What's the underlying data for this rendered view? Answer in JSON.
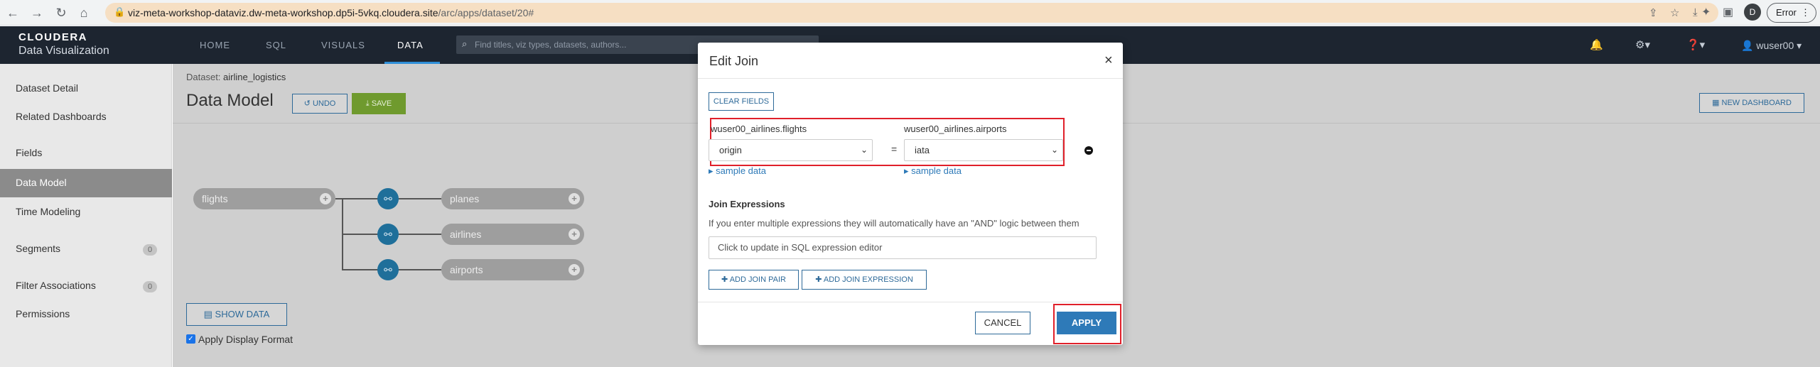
{
  "browser": {
    "url_host": "viz-meta-workshop-dataviz.dw-meta-workshop.dp5i-5vkq.cloudera.site",
    "url_path": "/arc/apps/dataset/20#",
    "profile_initial": "D",
    "error_label": "Error"
  },
  "navbar": {
    "brand_top": "CLOUDERA",
    "brand_bottom": "Data Visualization",
    "items": [
      "HOME",
      "SQL",
      "VISUALS",
      "DATA"
    ],
    "active": "DATA",
    "search_placeholder": "Find titles, viz types, datasets, authors...",
    "user": "wuser00"
  },
  "sidebar": {
    "items": [
      {
        "label": "Dataset Detail"
      },
      {
        "label": "Related Dashboards"
      },
      {
        "label": "Fields"
      },
      {
        "label": "Data Model"
      },
      {
        "label": "Time Modeling"
      },
      {
        "label": "Segments",
        "count": "0"
      },
      {
        "label": "Filter Associations",
        "count": "0"
      },
      {
        "label": "Permissions"
      }
    ],
    "active": "Data Model"
  },
  "main": {
    "dataset_prefix": "Dataset:",
    "dataset_name": "airline_logistics",
    "title": "Data Model",
    "undo_label": "UNDO",
    "save_label": "SAVE",
    "new_dashboard_label": "NEW DASHBOARD",
    "show_data_label": "SHOW DATA",
    "apply_format_label": "Apply Display Format",
    "join_diagram": {
      "left_table": "flights",
      "right_tables": [
        "planes",
        "airlines",
        "airports"
      ]
    }
  },
  "modal": {
    "title": "Edit Join",
    "clear_fields_label": "CLEAR FIELDS",
    "left_table": "wuser00_airlines.flights",
    "right_table": "wuser00_airlines.airports",
    "left_column": "origin",
    "right_column": "iata",
    "operator": "=",
    "sample_data_label": "sample data",
    "join_expr_title": "Join Expressions",
    "join_expr_desc": "If you enter multiple expressions they will automatically have an \"AND\" logic between them",
    "expr_placeholder": "Click to update in SQL expression editor",
    "add_join_pair_label": "ADD JOIN PAIR",
    "add_join_expr_label": "ADD JOIN EXPRESSION",
    "cancel_label": "CANCEL",
    "apply_label": "APPLY"
  },
  "colors": {
    "accent": "#2e7ab8",
    "navbar_bg": "#1d2530",
    "save_green": "#6f9a2e",
    "highlight_red": "#e0202a",
    "url_bar": "#f6dfc3"
  }
}
